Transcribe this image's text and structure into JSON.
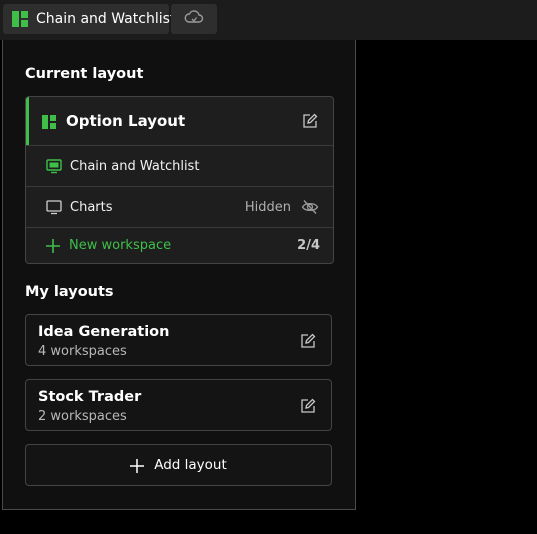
{
  "tabbar": {
    "active_tab_label": "Chain and Watchlist",
    "active_tab_icon": "layout-grid-icon",
    "cloud_icon": "cloud-sync-icon"
  },
  "panel": {
    "current_layout_title": "Current layout",
    "current_layout": {
      "name": "Option Layout",
      "icon": "layout-grid-icon",
      "workspaces": [
        {
          "label": "Chain and Watchlist",
          "icon": "monitor-active-icon",
          "status": ""
        },
        {
          "label": "Charts",
          "icon": "monitor-icon",
          "status": "Hidden"
        }
      ],
      "new_workspace_label": "New workspace",
      "workspace_count": "2/4"
    },
    "my_layouts_title": "My layouts",
    "my_layouts": [
      {
        "name": "Idea Generation",
        "subtitle": "4 workspaces"
      },
      {
        "name": "Stock Trader",
        "subtitle": "2 workspaces"
      }
    ],
    "add_layout_label": "Add layout"
  },
  "colors": {
    "accent_green": "#3fbf4a",
    "background": "#000000",
    "panel_bg": "#101010"
  }
}
